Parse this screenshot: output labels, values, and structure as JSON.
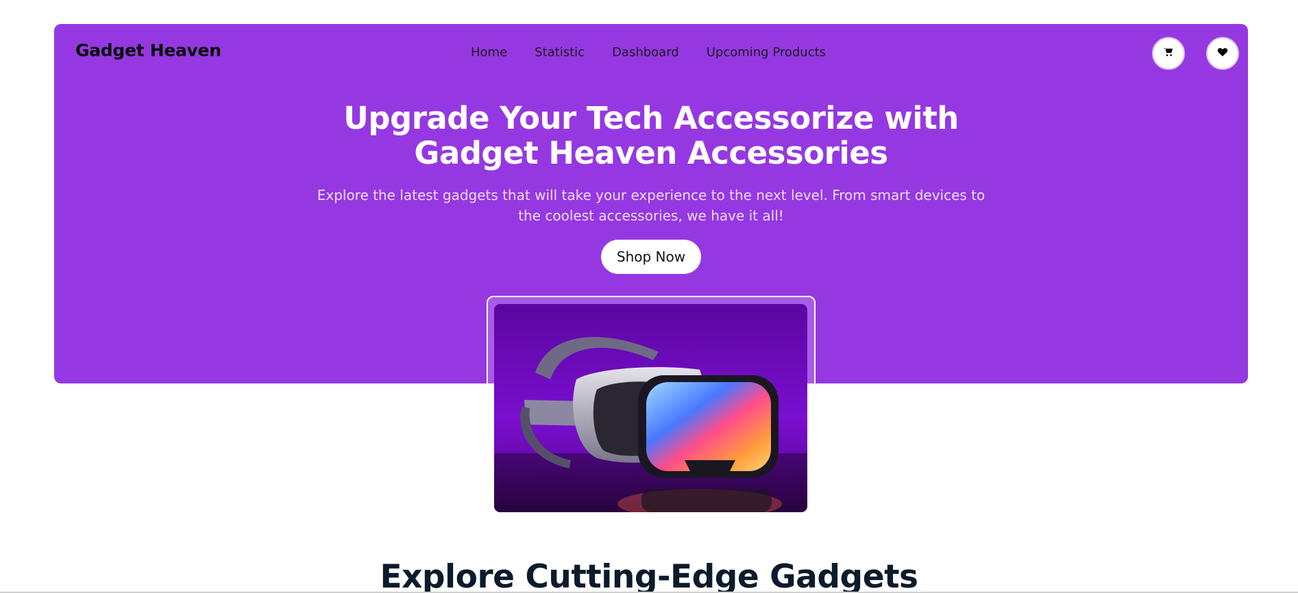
{
  "header": {
    "brand": "Gadget Heaven",
    "nav": [
      {
        "label": "Home"
      },
      {
        "label": "Statistic"
      },
      {
        "label": "Dashboard"
      },
      {
        "label": "Upcoming Products"
      }
    ],
    "icons": [
      "cart-icon",
      "heart-icon"
    ]
  },
  "hero": {
    "title_line1": "Upgrade Your Tech Accessorize with",
    "title_line2": "Gadget Heaven Accessories",
    "description_line1": "Explore the latest gadgets that will take your experience to the next level. From smart devices to",
    "description_line2": "the coolest accessories, we have it all!",
    "cta_label": "Shop Now",
    "background_color": "#9538e2"
  },
  "main": {
    "section_title": "Explore Cutting-Edge Gadgets"
  }
}
